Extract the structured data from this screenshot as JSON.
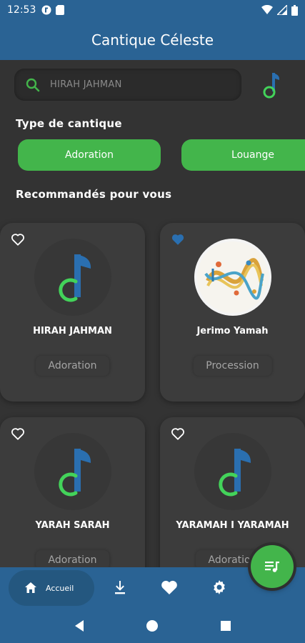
{
  "status_bar": {
    "time": "12:53"
  },
  "app_bar": {
    "title": "Cantique Céleste"
  },
  "search": {
    "placeholder": "HIRAH JAHMAN"
  },
  "sections": {
    "types_title": "Type de cantique",
    "recommended_title": "Recommandés pour vous"
  },
  "chips": [
    {
      "label": "Adoration"
    },
    {
      "label": "Louange"
    }
  ],
  "songs": [
    {
      "name": "HIRAH JAHMAN",
      "type": "Adoration",
      "favorite": false,
      "artwork": "music-note-icon"
    },
    {
      "name": "Jerimo Yamah",
      "type": "Procession",
      "favorite": true,
      "artwork": "music-sheet-image"
    },
    {
      "name": "YARAH SARAH",
      "type": "Adoration",
      "favorite": false,
      "artwork": "music-note-icon"
    },
    {
      "name": "YARAMAH I YARAMAH",
      "type": "Adoration",
      "favorite": false,
      "artwork": "music-note-icon"
    }
  ],
  "bottom_nav": {
    "home_label": "Accueil"
  },
  "colors": {
    "primary": "#2a6394",
    "accent": "#43b54b",
    "background": "#333333",
    "card": "#3c3c3c"
  }
}
